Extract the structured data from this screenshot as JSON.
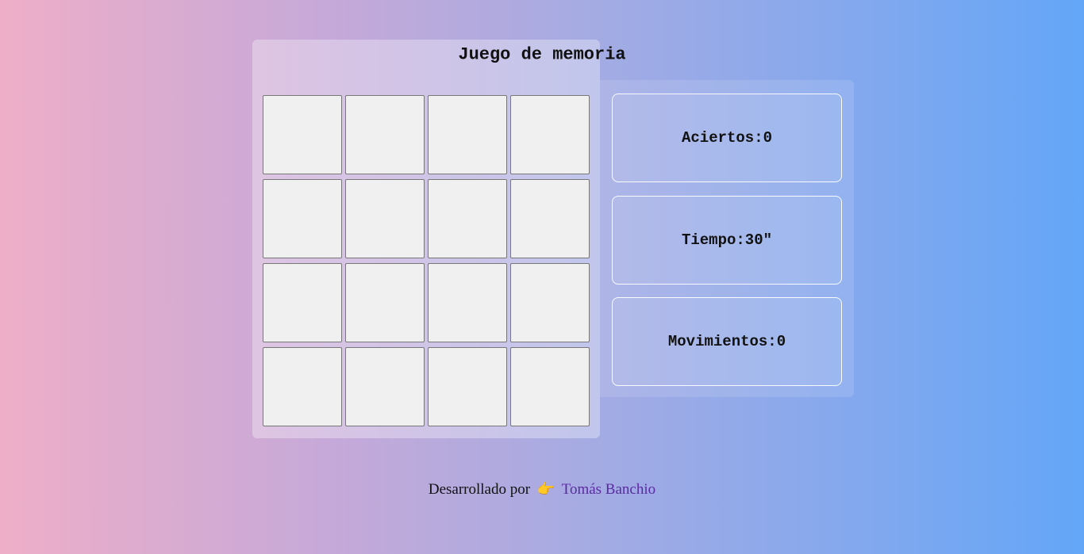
{
  "title": "Juego de memoria",
  "board": {
    "rows": 4,
    "cols": 4,
    "cards": [
      "",
      "",
      "",
      "",
      "",
      "",
      "",
      "",
      "",
      "",
      "",
      "",
      "",
      "",
      "",
      ""
    ]
  },
  "stats": {
    "hits_label": "Aciertos:",
    "hits_value": "0",
    "time_label": "Tiempo:",
    "time_value": "30\"",
    "moves_label": "Movimientos:",
    "moves_value": "0"
  },
  "footer": {
    "prefix": "Desarrollado por",
    "emoji": "👉",
    "author": "Tomás Banchio"
  },
  "colors": {
    "gradient_start": "#eeaec8",
    "gradient_end": "#63a6f7",
    "card_face": "#f0f0f0",
    "link": "#5b2aa0"
  },
  "icons": {
    "footer_pointer": "pointing-right-hand-icon"
  }
}
